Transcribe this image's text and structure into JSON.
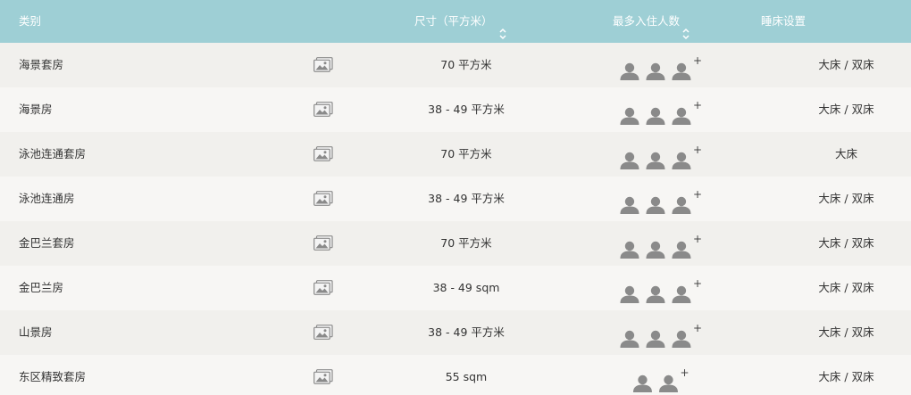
{
  "header": {
    "category": "类别",
    "size": "尺寸（平方米）",
    "max_occupancy": "最多入住人数",
    "bed_setup": "睡床设置"
  },
  "icons": {
    "sort": "sort-updown-icon",
    "photo": "photo-gallery-icon",
    "person": "person-icon"
  },
  "colors": {
    "header_bg": "#9ecfd5",
    "header_text": "#ffffff",
    "row_odd": "#f1f0ed",
    "row_even": "#f7f6f4",
    "icon_gray": "#8a8a8a"
  },
  "rooms": [
    {
      "name": "海景套房",
      "size": "70 平方米",
      "occupants": 3,
      "plus": "+",
      "bed": "大床 / 双床"
    },
    {
      "name": "海景房",
      "size": "38 - 49 平方米",
      "occupants": 3,
      "plus": "+",
      "bed": "大床 / 双床"
    },
    {
      "name": "泳池连通套房",
      "size": "70 平方米",
      "occupants": 3,
      "plus": "+",
      "bed": "大床"
    },
    {
      "name": "泳池连通房",
      "size": "38 - 49 平方米",
      "occupants": 3,
      "plus": "+",
      "bed": "大床 / 双床"
    },
    {
      "name": "金巴兰套房",
      "size": "70 平方米",
      "occupants": 3,
      "plus": "+",
      "bed": "大床 / 双床"
    },
    {
      "name": "金巴兰房",
      "size": "38 - 49 sqm",
      "occupants": 3,
      "plus": "+",
      "bed": "大床 / 双床"
    },
    {
      "name": "山景房",
      "size": "38 - 49 平方米",
      "occupants": 3,
      "plus": "+",
      "bed": "大床 / 双床"
    },
    {
      "name": "东区精致套房",
      "size": "55 sqm",
      "occupants": 2,
      "plus": "+",
      "bed": "大床 / 双床"
    }
  ]
}
